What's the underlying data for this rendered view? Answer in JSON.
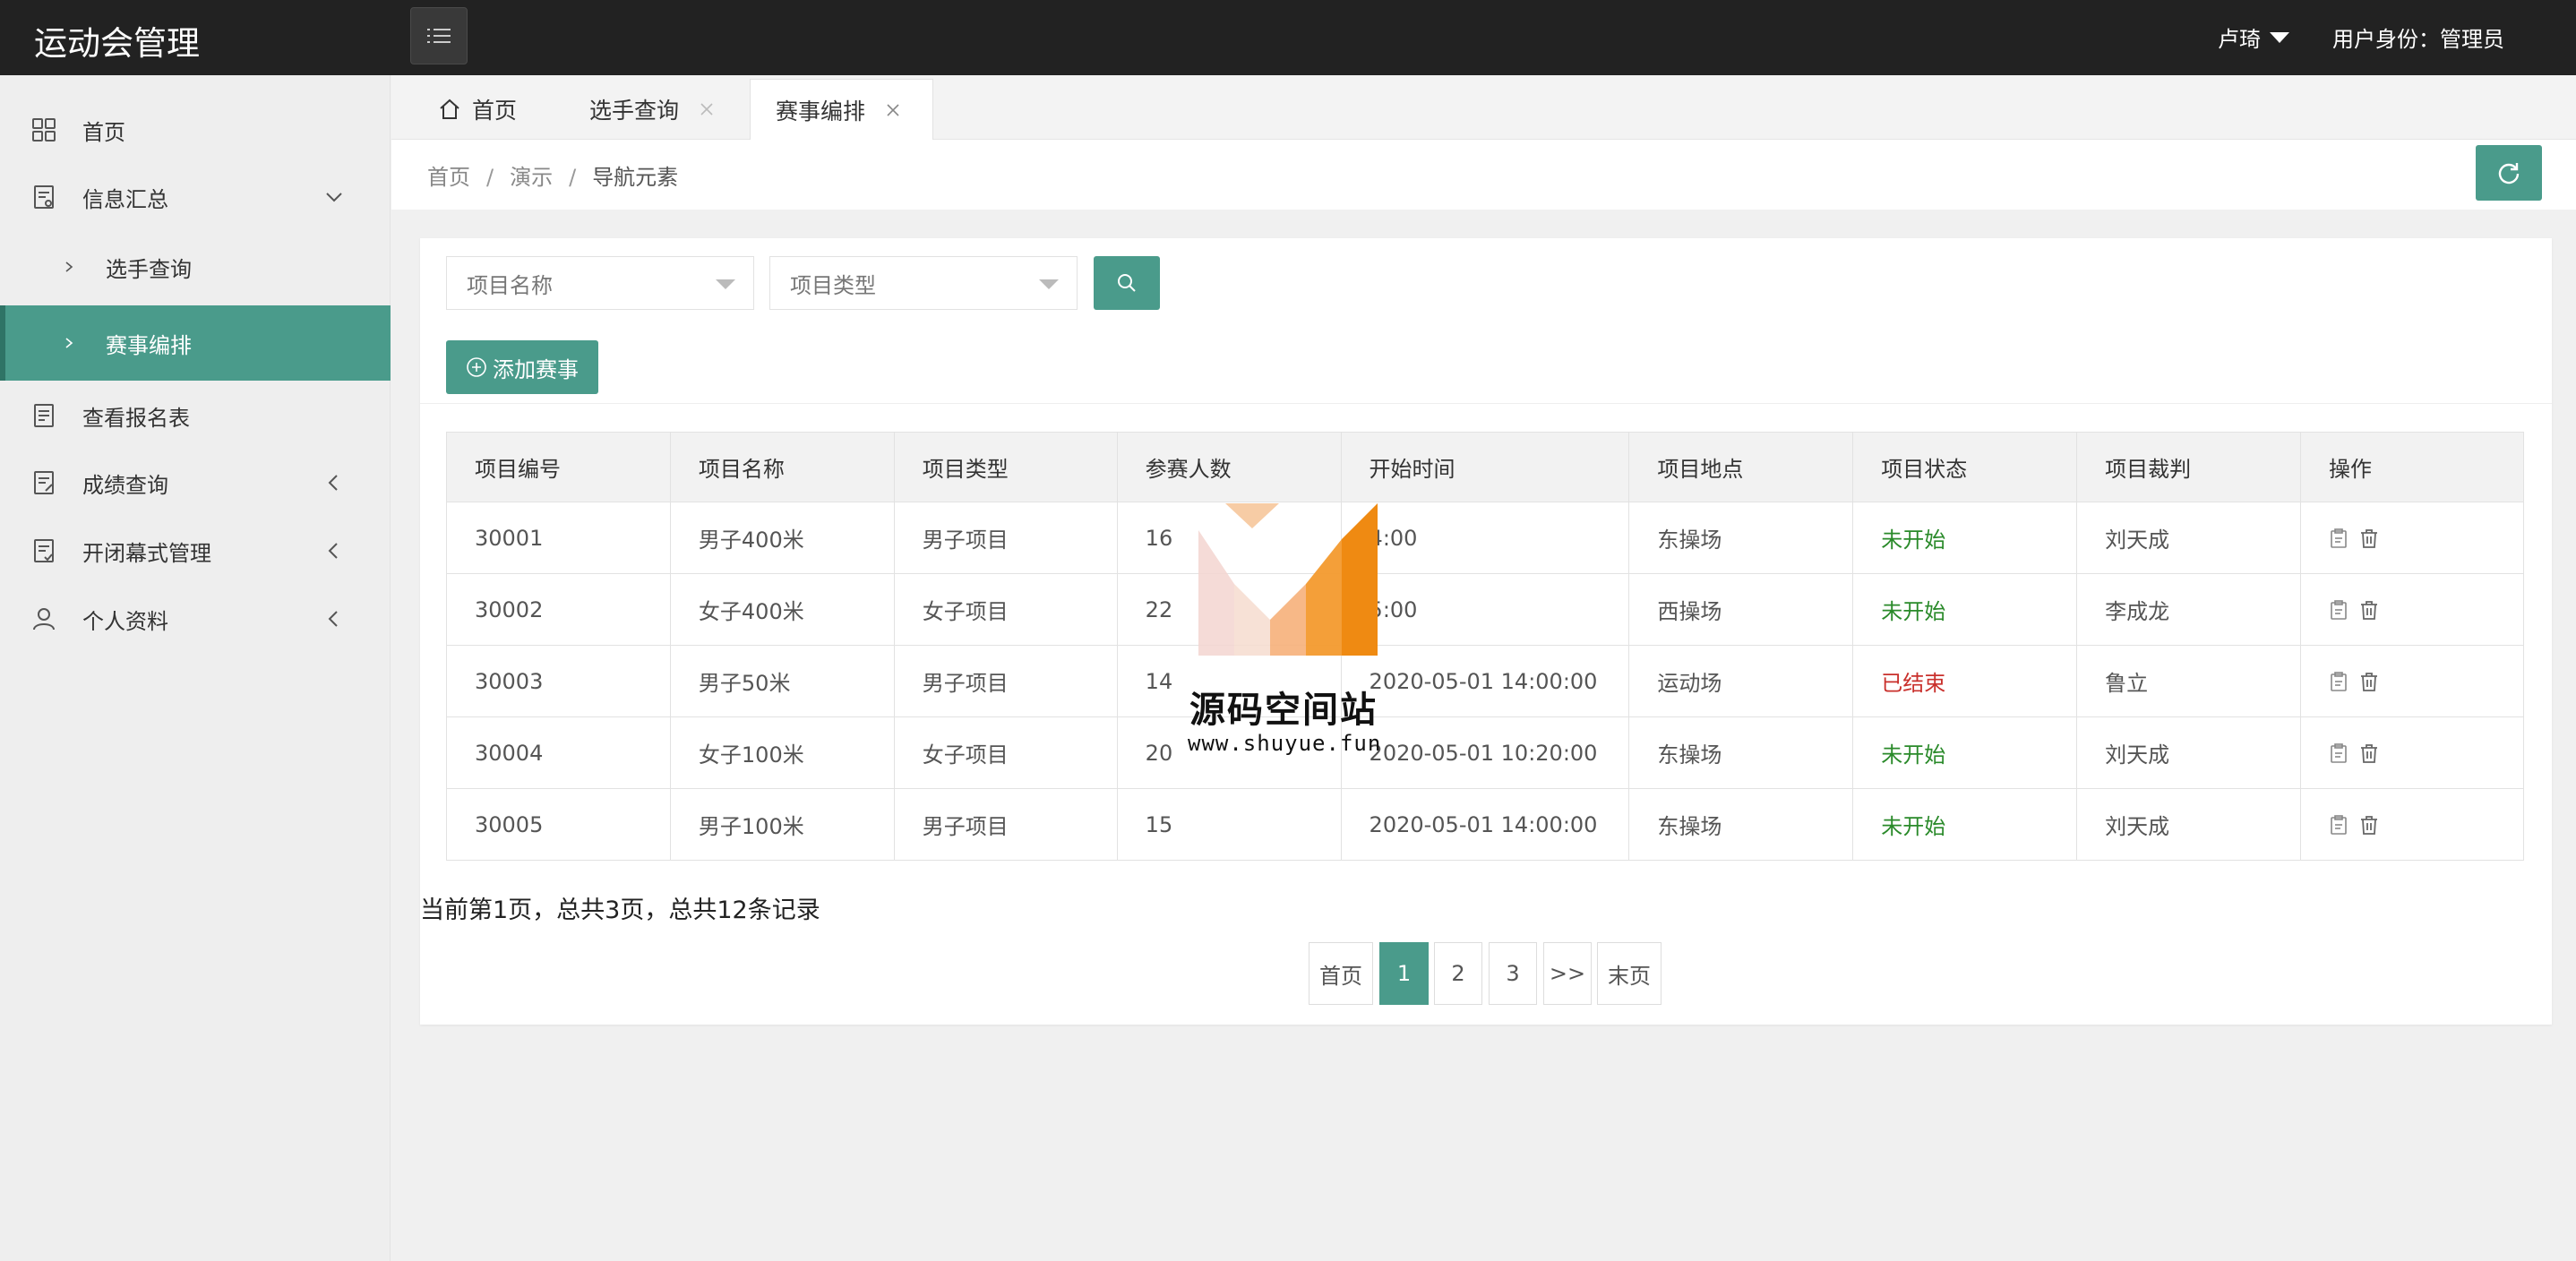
{
  "header": {
    "brand": "运动会管理",
    "user_name": "卢琦",
    "role": "用户身份：管理员"
  },
  "sidebar": {
    "items": [
      {
        "label": "首页",
        "icon": "grid-icon"
      },
      {
        "label": "信息汇总",
        "icon": "document-icon"
      },
      {
        "label": "选手查询"
      },
      {
        "label": "赛事编排"
      },
      {
        "label": "查看报名表",
        "icon": "form-icon"
      },
      {
        "label": "成绩查询",
        "icon": "document-icon"
      },
      {
        "label": "开闭幕式管理",
        "icon": "check-document-icon"
      },
      {
        "label": "个人资料",
        "icon": "user-icon"
      }
    ]
  },
  "tabs": [
    {
      "label": "首页"
    },
    {
      "label": "选手查询"
    },
    {
      "label": "赛事编排"
    }
  ],
  "breadcrumb": [
    "首页",
    "演示",
    "导航元素"
  ],
  "filters": {
    "name_placeholder": "项目名称",
    "type_placeholder": "项目类型"
  },
  "add_button": "添加赛事",
  "table": {
    "headers": [
      "项目编号",
      "项目名称",
      "项目类型",
      "参赛人数",
      "开始时间",
      "项目地点",
      "项目状态",
      "项目裁判",
      "操作"
    ],
    "rows": [
      {
        "id": "30001",
        "name": "男子400米",
        "type": "男子项目",
        "count": "16",
        "time": "4:00",
        "place": "东操场",
        "status": "未开始",
        "judge": "刘天成"
      },
      {
        "id": "30002",
        "name": "女子400米",
        "type": "女子项目",
        "count": "22",
        "time": "5:00",
        "place": "西操场",
        "status": "未开始",
        "judge": "李成龙"
      },
      {
        "id": "30003",
        "name": "男子50米",
        "type": "男子项目",
        "count": "14",
        "time": "2020-05-01 14:00:00",
        "place": "运动场",
        "status": "已结束",
        "judge": "鲁立"
      },
      {
        "id": "30004",
        "name": "女子100米",
        "type": "女子项目",
        "count": "20",
        "time": "2020-05-01 10:20:00",
        "place": "东操场",
        "status": "未开始",
        "judge": "刘天成"
      },
      {
        "id": "30005",
        "name": "男子100米",
        "type": "男子项目",
        "count": "15",
        "time": "2020-05-01 14:00:00",
        "place": "东操场",
        "status": "未开始",
        "judge": "刘天成"
      }
    ]
  },
  "pagination": {
    "info": "当前第1页，总共3页，总共12条记录",
    "first": "首页",
    "pages": [
      "1",
      "2",
      "3"
    ],
    "next": ">>",
    "last": "末页",
    "current": "1"
  },
  "watermark": {
    "title": "源码空间站",
    "url": "www.shuyue.fun"
  },
  "colors": {
    "accent": "#4a9b8b",
    "header_bg": "#222222",
    "status_pending": "#2a8a2a",
    "status_done": "#c9302c",
    "watermark_orange": "#f39a2e"
  }
}
